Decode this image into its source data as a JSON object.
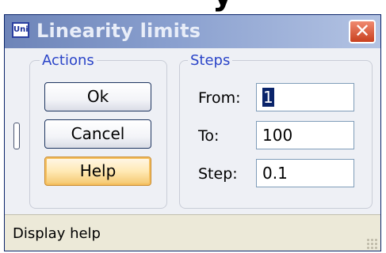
{
  "window": {
    "title": "Linearity limits",
    "app_icon_text": "Uni",
    "close_symbol": "✕"
  },
  "actions": {
    "legend": "Actions",
    "ok_label": "Ok",
    "cancel_label": "Cancel",
    "help_label": "Help"
  },
  "steps": {
    "legend": "Steps",
    "from_label": "From:",
    "from_value": "1",
    "to_label": "To:",
    "to_value": "100",
    "step_label": "Step:",
    "step_value": "0.1"
  },
  "statusbar": {
    "text": "Display help"
  },
  "colors": {
    "titlebar_start": "#6d84b8",
    "titlebar_end": "#b3c3e3",
    "legend_text": "#2a44c8",
    "close_button": "#c8401f",
    "focused_button_glow": "#f5c060"
  },
  "icons": [
    "close-icon",
    "app-icon",
    "size-grip-icon"
  ]
}
